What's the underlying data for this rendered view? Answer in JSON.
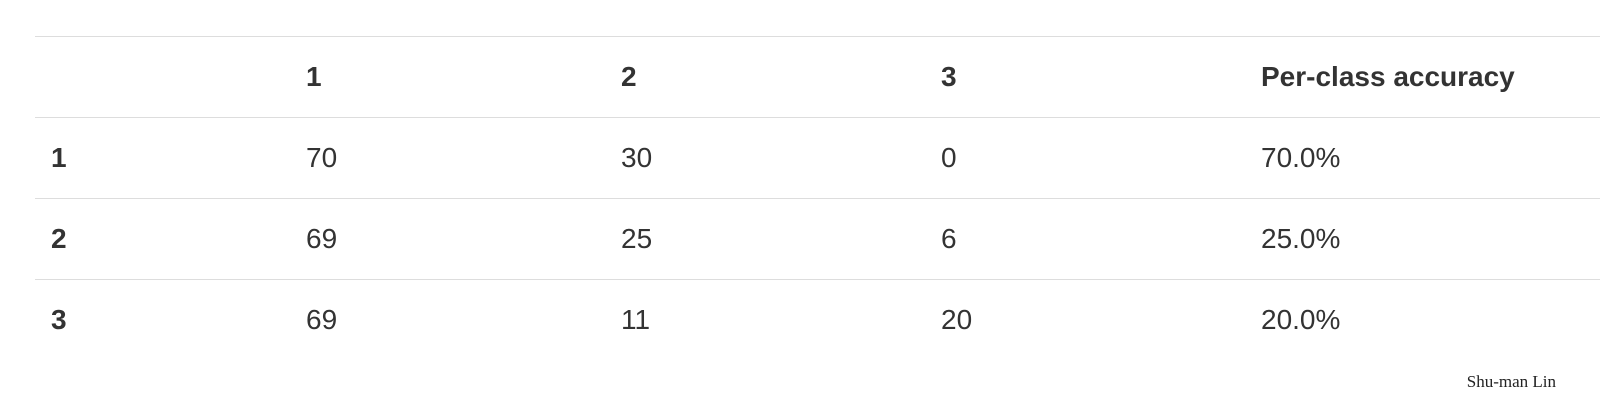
{
  "table": {
    "header": [
      "",
      "1",
      "2",
      "3",
      "Per-class accuracy"
    ],
    "rows": [
      {
        "label": "1",
        "cells": [
          "70",
          "30",
          "0",
          "70.0%"
        ]
      },
      {
        "label": "2",
        "cells": [
          "69",
          "25",
          "6",
          "25.0%"
        ]
      },
      {
        "label": "3",
        "cells": [
          "69",
          "11",
          "20",
          "20.0%"
        ]
      }
    ]
  },
  "credit": "Shu-man Lin"
}
